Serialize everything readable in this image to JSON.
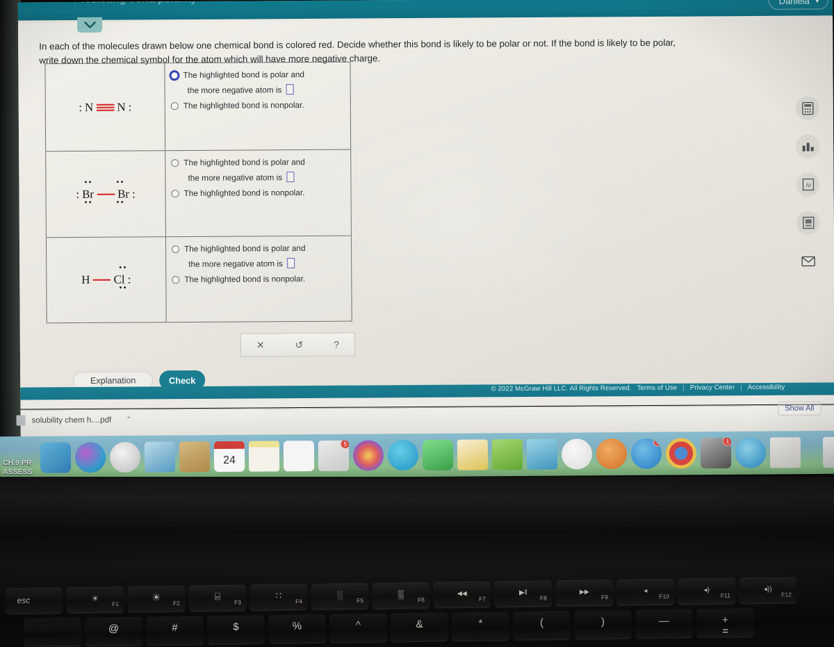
{
  "app": {
    "title": "Predicting bond polarity",
    "user_name": "Daniela",
    "user_chevron": "▾",
    "collapse_chevron": "⌄"
  },
  "prompt": {
    "line1": "In each of the molecules drawn below one chemical bond is colored red. Decide whether this bond is likely to be polar or not. If the bond is likely to be polar,",
    "line2": "write down the chemical symbol for the atom which will have more negative charge."
  },
  "questions": [
    {
      "molecule": {
        "name": "dinitrogen",
        "left_lone_pair": ":",
        "left_atom": "N",
        "bond_type": "triple",
        "bond_color": "#d51f1f",
        "right_atom": "N",
        "right_lone_pair": ":",
        "top_dots": "",
        "bottom_dots": ""
      },
      "option_polar": "The highlighted bond is polar and",
      "option_polar_sub": "the more negative atom is",
      "option_nonpolar": "The highlighted bond is nonpolar.",
      "answer_value": "",
      "polar_radio_focused": true,
      "polar_radio_selected": false,
      "nonpolar_radio_selected": false
    },
    {
      "molecule": {
        "name": "dibromine",
        "left_lone_pair": ":",
        "left_atom": "Br",
        "bond_type": "single",
        "bond_color": "#d51f1f",
        "right_atom": "Br",
        "right_lone_pair": ":",
        "top_dots": "••",
        "bottom_dots": "••"
      },
      "option_polar": "The highlighted bond is polar and",
      "option_polar_sub": "the more negative atom is",
      "option_nonpolar": "The highlighted bond is nonpolar.",
      "answer_value": "",
      "polar_radio_focused": false,
      "polar_radio_selected": false,
      "nonpolar_radio_selected": false
    },
    {
      "molecule": {
        "name": "hydrogen-chloride",
        "left_lone_pair": "",
        "left_atom": "H",
        "bond_type": "single",
        "bond_color": "#d51f1f",
        "right_atom": "Cl",
        "right_lone_pair": ":",
        "top_dots": "••",
        "bottom_dots": "••"
      },
      "option_polar": "The highlighted bond is polar and",
      "option_polar_sub": "the more negative atom is",
      "option_nonpolar": "The highlighted bond is nonpolar.",
      "answer_value": "",
      "polar_radio_focused": false,
      "polar_radio_selected": false,
      "nonpolar_radio_selected": false
    }
  ],
  "mini_toolbar": {
    "clear": "✕",
    "undo": "↺",
    "help": "?"
  },
  "actions": {
    "explanation": "Explanation",
    "check": "Check"
  },
  "footer": {
    "copyright": "© 2022 McGraw Hill LLC. All Rights Reserved.",
    "terms": "Terms of Use",
    "privacy": "Privacy Center",
    "accessibility": "Accessibility",
    "separator": "|"
  },
  "rail": [
    {
      "icon": "calculator-icon",
      "glyph": "⌨"
    },
    {
      "icon": "bar-chart-icon",
      "glyph": "█"
    },
    {
      "icon": "periodic-table-icon",
      "glyph": "At"
    },
    {
      "icon": "reference-table-icon",
      "glyph": "▤"
    },
    {
      "icon": "message-icon",
      "glyph": "✉"
    }
  ],
  "downloads": {
    "file_name": "solubility chem h....pdf",
    "chevron": "⌃",
    "show_all": "Show All"
  },
  "dock": [
    {
      "name": "finder",
      "label": "",
      "badge": "",
      "color1": "#4fb6e8",
      "color2": "#1d7fc4",
      "round": false
    },
    {
      "name": "siri",
      "label": "",
      "badge": "",
      "color1": "#b84ad8",
      "color2": "#2ea8e0",
      "round": true
    },
    {
      "name": "launchpad",
      "label": "",
      "badge": "",
      "color1": "#e8e8e8",
      "color2": "#bdbdbd",
      "round": true
    },
    {
      "name": "preview",
      "label": "",
      "badge": "",
      "color1": "#8ecbe8",
      "color2": "#4b9ccb",
      "round": false
    },
    {
      "name": "contacts",
      "label": "",
      "badge": "",
      "color1": "#d9b56f",
      "color2": "#b98d42",
      "round": false
    },
    {
      "name": "calendar",
      "label": "24",
      "badge": "",
      "color1": "#ffffff",
      "color2": "#e6e6e6",
      "round": false
    },
    {
      "name": "notes",
      "label": "",
      "badge": "",
      "color1": "#fdf6c8",
      "color2": "#f2e58a",
      "round": false
    },
    {
      "name": "reminders",
      "label": "",
      "badge": "",
      "color1": "#ffffff",
      "color2": "#ededed",
      "round": false
    },
    {
      "name": "mail",
      "label": "",
      "badge": "5",
      "color1": "#e8e8e8",
      "color2": "#c7c7c7",
      "round": false
    },
    {
      "name": "photos",
      "label": "",
      "badge": "",
      "color1": "#ffffff",
      "color2": "#f0f0f0",
      "round": true
    },
    {
      "name": "messages",
      "label": "",
      "badge": "",
      "color1": "#3fc8ec",
      "color2": "#1aa4d8",
      "round": true
    },
    {
      "name": "facetime",
      "label": "",
      "badge": "",
      "color1": "#5fd96a",
      "color2": "#2fb03f",
      "round": false
    },
    {
      "name": "pages",
      "label": "",
      "badge": "",
      "color1": "#fbe7a5",
      "color2": "#e9c94f",
      "round": false
    },
    {
      "name": "numbers",
      "label": "",
      "badge": "",
      "color1": "#8fd24f",
      "color2": "#5fae2a",
      "round": false
    },
    {
      "name": "keynote",
      "label": "",
      "badge": "",
      "color1": "#6fc9e8",
      "color2": "#3a9cc8",
      "round": false
    },
    {
      "name": "itunes",
      "label": "",
      "badge": "",
      "color1": "#ffffff",
      "color2": "#ededed",
      "round": true
    },
    {
      "name": "ibooks",
      "label": "",
      "badge": "",
      "color1": "#f59f3b",
      "color2": "#e06f1d",
      "round": true
    },
    {
      "name": "app-store",
      "label": "A",
      "badge": "1",
      "color1": "#4fb0ea",
      "color2": "#1e7fd0",
      "round": true
    },
    {
      "name": "chrome",
      "label": "",
      "badge": "",
      "color1": "#ffffff",
      "color2": "#f2f2f2",
      "round": true
    },
    {
      "name": "system-preferences",
      "label": "",
      "badge": "1",
      "color1": "#9a9a9a",
      "color2": "#5e5e5e",
      "round": false
    },
    {
      "name": "safari",
      "label": "",
      "badge": "",
      "color1": "#5fc6f2",
      "color2": "#1f8fd4",
      "round": true
    },
    {
      "name": "aleks-window",
      "label": "",
      "badge": "",
      "color1": "#e8e6df",
      "color2": "#cfcdc6",
      "round": false
    },
    {
      "name": "trash",
      "label": "",
      "badge": "",
      "color1": "#e9ece9",
      "color2": "#c7ccc7",
      "round": false
    }
  ],
  "overlay": {
    "line1": "CH.9 PR",
    "line2": "ASSESS"
  },
  "laptop": {
    "wordmark": "MacBook Air",
    "fn_keys": [
      {
        "label": "esc",
        "fx": "",
        "glyph": "esc"
      },
      {
        "label": "brightness-down",
        "fx": "F1",
        "glyph": "☀"
      },
      {
        "label": "brightness-up",
        "fx": "F2",
        "glyph": "☀"
      },
      {
        "label": "mission-control",
        "fx": "F3",
        "glyph": "⌸"
      },
      {
        "label": "launchpad",
        "fx": "F4",
        "glyph": "∷"
      },
      {
        "label": "keyboard-light-down",
        "fx": "F5",
        "glyph": "░"
      },
      {
        "label": "keyboard-light-up",
        "fx": "F6",
        "glyph": "▒"
      },
      {
        "label": "rewind",
        "fx": "F7",
        "glyph": "◀◀"
      },
      {
        "label": "play-pause",
        "fx": "F8",
        "glyph": "▶‖"
      },
      {
        "label": "fast-forward",
        "fx": "F9",
        "glyph": "▶▶"
      },
      {
        "label": "mute",
        "fx": "F10",
        "glyph": "◂"
      },
      {
        "label": "volume-down",
        "fx": "F11",
        "glyph": "◂)"
      },
      {
        "label": "volume-up",
        "fx": "F12",
        "glyph": "◂))"
      }
    ],
    "number_row": [
      "",
      "@",
      "#",
      "$",
      "%",
      "^",
      "&",
      "*",
      "(",
      ")",
      "—",
      "+",
      "="
    ]
  }
}
